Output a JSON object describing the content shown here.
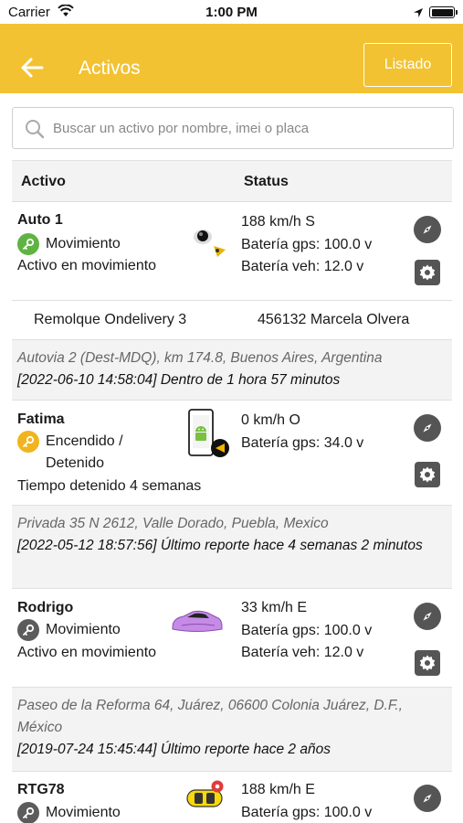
{
  "status_bar": {
    "carrier": "Carrier",
    "time": "1:00 PM"
  },
  "header": {
    "title": "Activos",
    "list_button": "Listado",
    "accent_color": "#f2c232"
  },
  "search": {
    "placeholder": "Buscar un activo por nombre, imei o placa",
    "value": ""
  },
  "table": {
    "col_asset": "Activo",
    "col_status": "Status"
  },
  "assets": [
    {
      "name": "Auto 1",
      "state": "Movimiento",
      "state_icon": "key-icon",
      "state_color": "#5fb342",
      "sub": "Activo en movimiento",
      "speed": "188 km/h S",
      "gps_battery": "Batería gps: 100.0 v",
      "veh_battery": "Batería veh: 12.0 v",
      "extra_left": "Remolque Ondelivery 3",
      "extra_right": "456132 Marcela Olvera",
      "address": "Autovia 2 (Dest-MDQ), km 174.8, Buenos Aires, Argentina",
      "report": "[2022-06-10 14:58:04] Dentro de 1 hora 57 minutos"
    },
    {
      "name": "Fatima",
      "state": "Encendido /",
      "state2": "Detenido",
      "state_icon": "key-icon",
      "state_color": "#f0b51e",
      "sub": "Tiempo detenido 4 semanas",
      "speed": "0 km/h O",
      "gps_battery": "Batería gps: 34.0 v",
      "address": "Privada 35 N 2612, Valle Dorado, Puebla, Mexico",
      "report": "[2022-05-12 18:57:56] Último reporte hace 4 semanas 2 minutos"
    },
    {
      "name": "Rodrigo",
      "state": "Movimiento",
      "state_icon": "key-icon",
      "state_color": "#5c5c5c",
      "sub": "Activo en movimiento",
      "speed": "33 km/h E",
      "gps_battery": "Batería gps: 100.0 v",
      "veh_battery": "Batería veh: 12.0 v",
      "address": "Paseo de la Reforma 64, Juárez, 06600 Colonia Juárez, D.F., México",
      "report": "[2019-07-24 15:45:44] Último reporte hace 2 años"
    },
    {
      "name": "RTG78",
      "state": "Movimiento",
      "state_icon": "key-icon",
      "state_color": "#5c5c5c",
      "speed": "188 km/h E",
      "gps_battery": "Batería gps: 100.0 v"
    }
  ]
}
